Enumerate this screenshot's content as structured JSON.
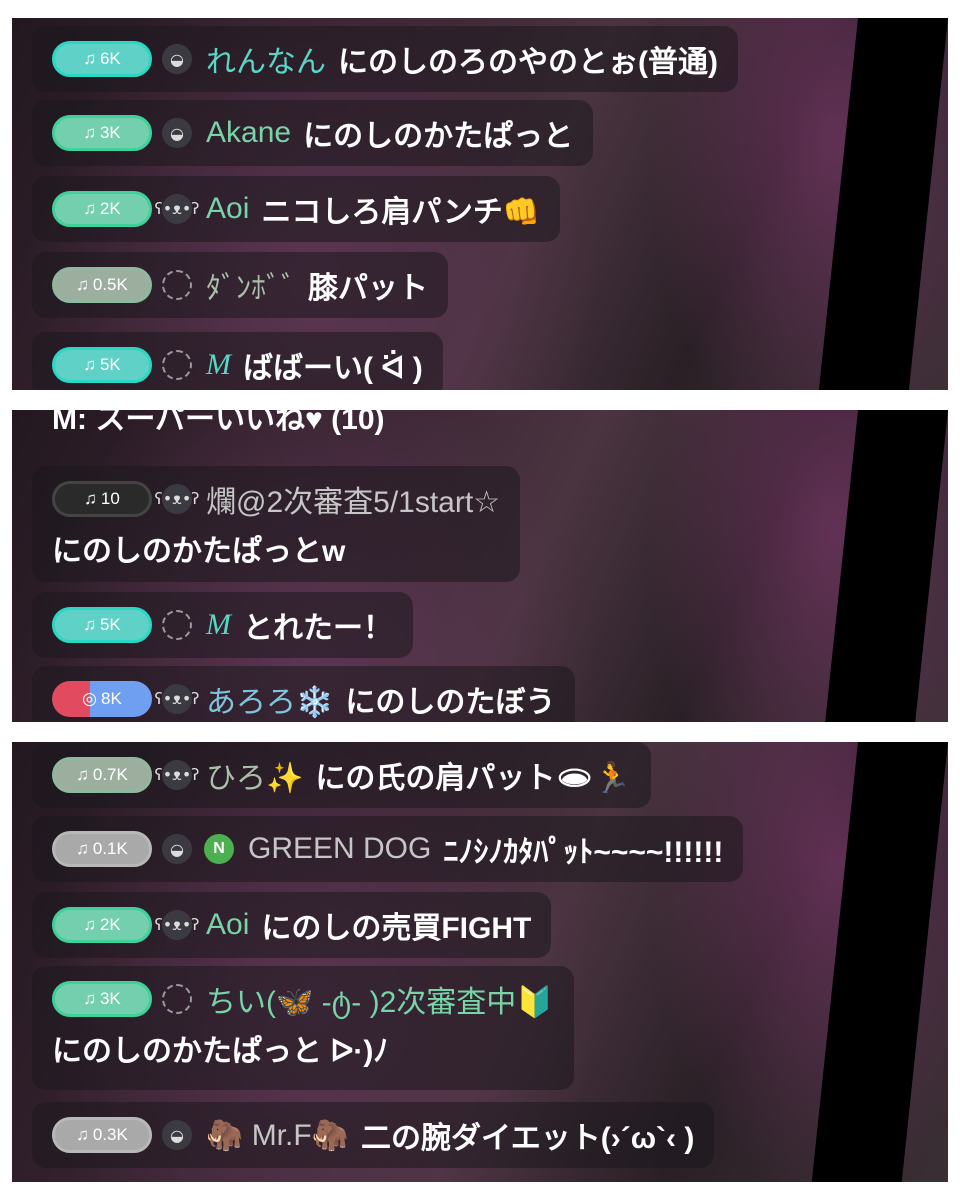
{
  "panels": [
    {
      "rows": [
        {
          "badge": "6K",
          "name": "れんなん",
          "message": "にのしのろのやのとぉ(普通)"
        },
        {
          "badge": "3K",
          "name": "Akane",
          "message": "にのしのかたぱっと"
        },
        {
          "badge": "2K",
          "name": "Aoi",
          "message": "ニコしろ肩パンチ👊"
        },
        {
          "badge": "0.5K",
          "name": "ﾀﾞﾝﾎﾞﾞ",
          "message": "膝パット"
        },
        {
          "badge": "5K",
          "name": "M",
          "message": "ばばーい( ᐛ )"
        }
      ]
    },
    {
      "top_text": "M: スーパーいいね♥ (10)",
      "rows": [
        {
          "badge": "10",
          "name": "爛@2次審査5/1start☆",
          "message": "にのしのかたぱっとw"
        },
        {
          "badge": "5K",
          "name": "M",
          "message": "とれたー！"
        },
        {
          "badge": "8K",
          "name": "あろろ❄️",
          "message": "にのしのたぼう"
        }
      ]
    },
    {
      "rows": [
        {
          "badge": "0.7K",
          "name": "ひろ✨",
          "message": "にの氏の肩パット🕳🏃"
        },
        {
          "badge": "0.1K",
          "badge_letter": "N",
          "name": "GREEN DOG",
          "message": "ﾆﾉｼﾉｶﾀﾊﾟｯﾄ~~~~!!!!!!"
        },
        {
          "badge": "2K",
          "name": "Aoi",
          "message": "にのしの売買FIGHT"
        },
        {
          "badge": "3K",
          "name": "ちい(🦋 -ტ- )2次審査中🔰",
          "message": "にのしのかたぱっと ᐅ·)ﾉ"
        },
        {
          "badge": "0.3K",
          "name": "🦣 Mr.F🦣",
          "message": "二の腕ダイエット(›´ω`‹ )"
        }
      ]
    }
  ],
  "icons": {
    "note": "music-note-icon",
    "avatars": [
      "whale-icon",
      "bear-icon",
      "dashed-circle-icon"
    ]
  },
  "colors": {
    "teal": "#58d6c6",
    "green": "#78d3a6",
    "badge_border": "#29d8c4",
    "background": "#2e2229"
  }
}
